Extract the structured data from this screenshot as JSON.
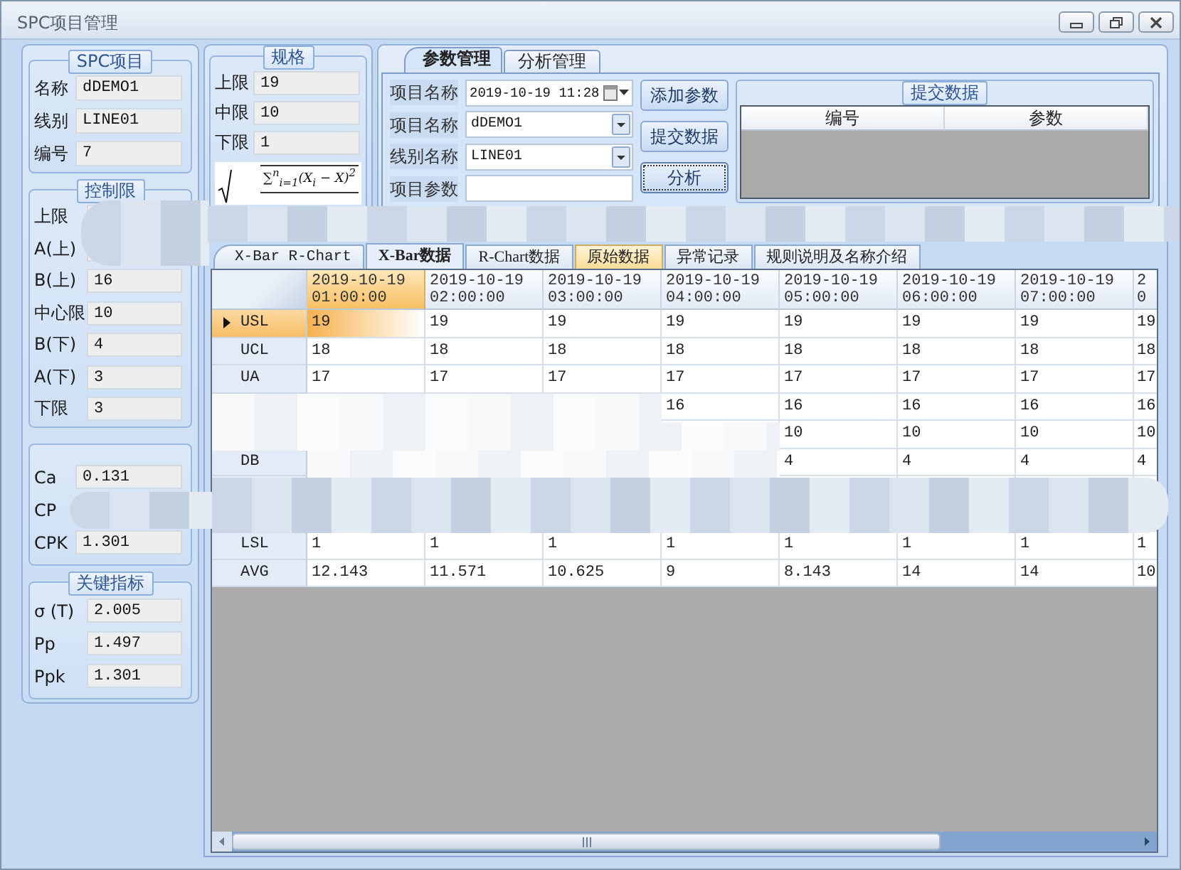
{
  "window": {
    "title": "SPC项目管理"
  },
  "project": {
    "title": "SPC项目",
    "fields": [
      {
        "label": "名称",
        "value": "dDEMO1"
      },
      {
        "label": "线别",
        "value": "LINE01"
      },
      {
        "label": "编号",
        "value": "7"
      }
    ]
  },
  "control_limits": {
    "title": "控制限",
    "fields": [
      {
        "label": "上限"
      },
      {
        "label": "A(上)"
      },
      {
        "label": "B(上)",
        "value": "16"
      },
      {
        "label": "中心限",
        "value": "10"
      },
      {
        "label": "B(下)",
        "value": "4"
      },
      {
        "label": "A(下)",
        "value": "3"
      },
      {
        "label": "下限",
        "value": "3"
      }
    ]
  },
  "capability": {
    "fields": [
      {
        "label": "Ca",
        "value": "0.131"
      },
      {
        "label": "CP"
      },
      {
        "label": "CPK",
        "value": "1.301"
      }
    ]
  },
  "key_metrics": {
    "title": "关键指标",
    "fields": [
      {
        "label": "σ (T)",
        "value": "2.005"
      },
      {
        "label": "Pp",
        "value": "1.497"
      },
      {
        "label": "Ppk",
        "value": "1.301"
      }
    ]
  },
  "spec": {
    "title": "规格",
    "fields": [
      {
        "label": "上限",
        "value": "19"
      },
      {
        "label": "中限",
        "value": "10"
      },
      {
        "label": "下限",
        "value": "1"
      }
    ],
    "formula": "∑$^{n}$$_{i=1}$(X$_{i}$ − X)$^{2}$"
  },
  "param_tabs": [
    {
      "label": "参数管理",
      "selected": true
    },
    {
      "label": "分析管理",
      "selected": false
    }
  ],
  "param_form": [
    {
      "label": "项目名称",
      "kind": "datetime",
      "value": "2019-10-19 11:28"
    },
    {
      "label": "项目名称",
      "kind": "combo",
      "value": "dDEMO1"
    },
    {
      "label": "线别名称",
      "kind": "combo",
      "value": "LINE01"
    },
    {
      "label": "项目参数",
      "kind": "text"
    }
  ],
  "actions": [
    {
      "label": "添加参数",
      "focused": false
    },
    {
      "label": "提交数据",
      "focused": false
    },
    {
      "label": "分析",
      "focused": true
    }
  ],
  "submit_group": {
    "title": "提交数据",
    "columns": [
      "编号",
      "参数"
    ]
  },
  "data_tabs": [
    {
      "label": "X-Bar R-Chart",
      "selected": false,
      "highlighted": false
    },
    {
      "label": "X-Bar数据",
      "selected": true,
      "highlighted": false
    },
    {
      "label": "R-Chart数据",
      "selected": false,
      "highlighted": false
    },
    {
      "label": "原始数据",
      "selected": false,
      "highlighted": true
    },
    {
      "label": "异常记录",
      "selected": false,
      "highlighted": false
    },
    {
      "label": "规则说明及名称介绍",
      "selected": false,
      "highlighted": false
    }
  ],
  "grid": {
    "columns": [
      {
        "date": "2019-10-19",
        "time": "01:00:00",
        "selected": true
      },
      {
        "date": "2019-10-19",
        "time": "02:00:00",
        "selected": false
      },
      {
        "date": "2019-10-19",
        "time": "03:00:00",
        "selected": false
      },
      {
        "date": "2019-10-19",
        "time": "04:00:00",
        "selected": false
      },
      {
        "date": "2019-10-19",
        "time": "05:00:00",
        "selected": false
      },
      {
        "date": "2019-10-19",
        "time": "06:00:00",
        "selected": false
      },
      {
        "date": "2019-10-19",
        "time": "07:00:00",
        "selected": false
      },
      {
        "date": "2",
        "time": "0",
        "selected": false
      }
    ],
    "rows": [
      {
        "label": "USL",
        "selected": true,
        "cells": [
          "19",
          "19",
          "19",
          "19",
          "19",
          "19",
          "19",
          "19"
        ]
      },
      {
        "label": "UCL",
        "selected": false,
        "cells": [
          "18",
          "18",
          "18",
          "18",
          "18",
          "18",
          "18",
          "18"
        ]
      },
      {
        "label": "UA",
        "selected": false,
        "cells": [
          "17",
          "17",
          "17",
          "17",
          "17",
          "17",
          "17",
          "17"
        ]
      },
      {
        "cells": [
          null,
          null,
          null,
          "16",
          "16",
          "16",
          "16",
          "16"
        ]
      },
      {
        "cells": [
          null,
          null,
          null,
          null,
          "10",
          "10",
          "10",
          "10"
        ]
      },
      {
        "label": "DB",
        "selected": false,
        "cells": [
          null,
          null,
          null,
          null,
          "4",
          "4",
          "4",
          "4"
        ]
      },
      {
        "cells": [
          null,
          null,
          null,
          null,
          null,
          null,
          null,
          null
        ]
      },
      {
        "cells": [
          null,
          null,
          null,
          null,
          null,
          null,
          null,
          null
        ]
      },
      {
        "label": "LSL",
        "selected": false,
        "cells": [
          "1",
          "1",
          "1",
          "1",
          "1",
          "1",
          "1",
          "1"
        ]
      },
      {
        "label": "AVG",
        "selected": false,
        "cells": [
          "12.143",
          "11.571",
          "10.625",
          "9",
          "8.143",
          "14",
          "14",
          "10"
        ]
      }
    ]
  }
}
